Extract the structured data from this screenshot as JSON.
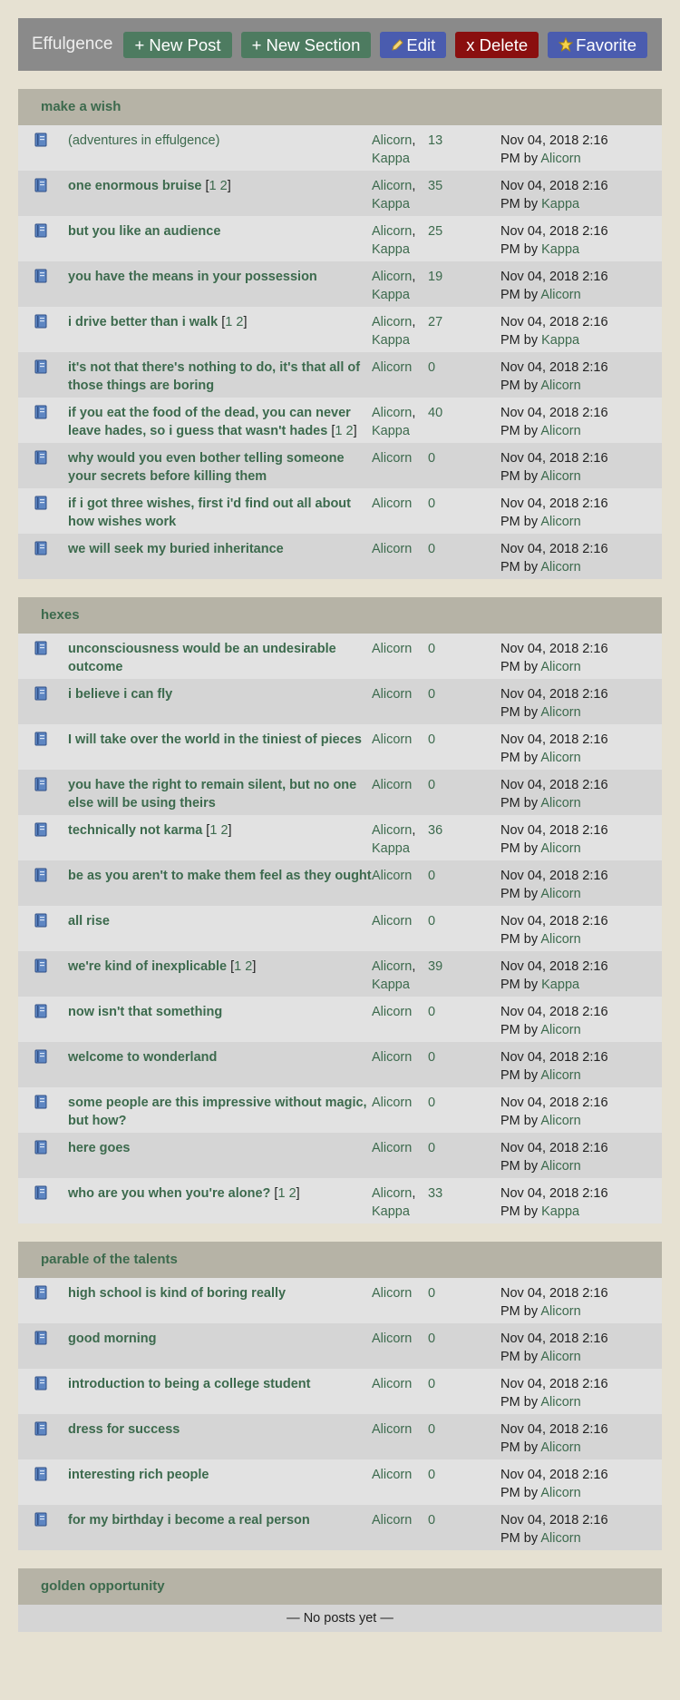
{
  "app": {
    "title": "Effulgence"
  },
  "toolbar": {
    "new_post": "+ New Post",
    "new_section": "+ New Section",
    "edit": "Edit",
    "delete": "x Delete",
    "favorite": "Favorite"
  },
  "colors": {
    "link": "#3c6a4d",
    "background": "#e6e1d2",
    "header": "#b6b3a6",
    "toolbar": "#8a8a8a"
  },
  "sections": [
    {
      "title": "make a wish",
      "posts": [
        {
          "title": "(adventures in effulgence)",
          "plain": true,
          "pages": [],
          "authors": [
            "Alicorn",
            "Kappa"
          ],
          "replies": "13",
          "date": "Nov 04, 2018 2:16 PM",
          "by": "by",
          "last_author": "Alicorn"
        },
        {
          "title": "one enormous bruise",
          "pages": [
            "1",
            "2"
          ],
          "authors": [
            "Alicorn",
            "Kappa"
          ],
          "replies": "35",
          "date": "Nov 04, 2018 2:16 PM",
          "by": "by",
          "last_author": "Kappa"
        },
        {
          "title": "but you like an audience",
          "pages": [],
          "authors": [
            "Alicorn",
            "Kappa"
          ],
          "replies": "25",
          "date": "Nov 04, 2018 2:16 PM",
          "by": "by",
          "last_author": "Kappa"
        },
        {
          "title": "you have the means in your possession",
          "pages": [],
          "authors": [
            "Alicorn",
            "Kappa"
          ],
          "replies": "19",
          "date": "Nov 04, 2018 2:16 PM",
          "by": "by",
          "last_author": "Alicorn"
        },
        {
          "title": "i drive better than i walk",
          "pages": [
            "1",
            "2"
          ],
          "authors": [
            "Alicorn",
            "Kappa"
          ],
          "replies": "27",
          "date": "Nov 04, 2018 2:16 PM",
          "by": "by",
          "last_author": "Kappa"
        },
        {
          "title": "it's not that there's nothing to do, it's that all of those things are boring",
          "pages": [],
          "authors": [
            "Alicorn"
          ],
          "replies": "0",
          "date": "Nov 04, 2018 2:16 PM",
          "by": "by",
          "last_author": "Alicorn"
        },
        {
          "title": "if you eat the food of the dead, you can never leave hades, so i guess that wasn't hades",
          "pages": [
            "1",
            "2"
          ],
          "authors": [
            "Alicorn",
            "Kappa"
          ],
          "replies": "40",
          "date": "Nov 04, 2018 2:16 PM",
          "by": "by",
          "last_author": "Alicorn"
        },
        {
          "title": "why would you even bother telling someone your secrets before killing them",
          "pages": [],
          "authors": [
            "Alicorn"
          ],
          "replies": "0",
          "date": "Nov 04, 2018 2:16 PM",
          "by": "by",
          "last_author": "Alicorn"
        },
        {
          "title": "if i got three wishes, first i'd find out all about how wishes work",
          "pages": [],
          "authors": [
            "Alicorn"
          ],
          "replies": "0",
          "date": "Nov 04, 2018 2:16 PM",
          "by": "by",
          "last_author": "Alicorn"
        },
        {
          "title": "we will seek my buried inheritance",
          "pages": [],
          "authors": [
            "Alicorn"
          ],
          "replies": "0",
          "date": "Nov 04, 2018 2:16 PM",
          "by": "by",
          "last_author": "Alicorn"
        }
      ]
    },
    {
      "title": "hexes",
      "posts": [
        {
          "title": "unconsciousness would be an undesirable outcome",
          "pages": [],
          "authors": [
            "Alicorn"
          ],
          "replies": "0",
          "date": "Nov 04, 2018 2:16 PM",
          "by": "by",
          "last_author": "Alicorn"
        },
        {
          "title": "i believe i can fly",
          "pages": [],
          "authors": [
            "Alicorn"
          ],
          "replies": "0",
          "date": "Nov 04, 2018 2:16 PM",
          "by": "by",
          "last_author": "Alicorn"
        },
        {
          "title": "I will take over the world in the tiniest of pieces",
          "pages": [],
          "authors": [
            "Alicorn"
          ],
          "replies": "0",
          "date": "Nov 04, 2018 2:16 PM",
          "by": "by",
          "last_author": "Alicorn"
        },
        {
          "title": "you have the right to remain silent, but no one else will be using theirs",
          "pages": [],
          "authors": [
            "Alicorn"
          ],
          "replies": "0",
          "date": "Nov 04, 2018 2:16 PM",
          "by": "by",
          "last_author": "Alicorn"
        },
        {
          "title": "technically not karma",
          "pages": [
            "1",
            "2"
          ],
          "authors": [
            "Alicorn",
            "Kappa"
          ],
          "replies": "36",
          "date": "Nov 04, 2018 2:16 PM",
          "by": "by",
          "last_author": "Alicorn"
        },
        {
          "title": "be as you aren't to make them feel as they ought",
          "pages": [],
          "authors": [
            "Alicorn"
          ],
          "replies": "0",
          "date": "Nov 04, 2018 2:16 PM",
          "by": "by",
          "last_author": "Alicorn"
        },
        {
          "title": "all rise",
          "pages": [],
          "authors": [
            "Alicorn"
          ],
          "replies": "0",
          "date": "Nov 04, 2018 2:16 PM",
          "by": "by",
          "last_author": "Alicorn"
        },
        {
          "title": "we're kind of inexplicable",
          "pages": [
            "1",
            "2"
          ],
          "authors": [
            "Alicorn",
            "Kappa"
          ],
          "replies": "39",
          "date": "Nov 04, 2018 2:16 PM",
          "by": "by",
          "last_author": "Kappa"
        },
        {
          "title": "now isn't that something",
          "pages": [],
          "authors": [
            "Alicorn"
          ],
          "replies": "0",
          "date": "Nov 04, 2018 2:16 PM",
          "by": "by",
          "last_author": "Alicorn"
        },
        {
          "title": "welcome to wonderland",
          "pages": [],
          "authors": [
            "Alicorn"
          ],
          "replies": "0",
          "date": "Nov 04, 2018 2:16 PM",
          "by": "by",
          "last_author": "Alicorn"
        },
        {
          "title": "some people are this impressive without magic, but how?",
          "pages": [],
          "authors": [
            "Alicorn"
          ],
          "replies": "0",
          "date": "Nov 04, 2018 2:16 PM",
          "by": "by",
          "last_author": "Alicorn"
        },
        {
          "title": "here goes",
          "pages": [],
          "authors": [
            "Alicorn"
          ],
          "replies": "0",
          "date": "Nov 04, 2018 2:16 PM",
          "by": "by",
          "last_author": "Alicorn"
        },
        {
          "title": "who are you when you're alone?",
          "pages": [
            "1",
            "2"
          ],
          "authors": [
            "Alicorn",
            "Kappa"
          ],
          "replies": "33",
          "date": "Nov 04, 2018 2:16 PM",
          "by": "by",
          "last_author": "Kappa"
        }
      ]
    },
    {
      "title": "parable of the talents",
      "posts": [
        {
          "title": "high school is kind of boring really",
          "pages": [],
          "authors": [
            "Alicorn"
          ],
          "replies": "0",
          "date": "Nov 04, 2018 2:16 PM",
          "by": "by",
          "last_author": "Alicorn"
        },
        {
          "title": "good morning",
          "pages": [],
          "authors": [
            "Alicorn"
          ],
          "replies": "0",
          "date": "Nov 04, 2018 2:16 PM",
          "by": "by",
          "last_author": "Alicorn"
        },
        {
          "title": "introduction to being a college student",
          "pages": [],
          "authors": [
            "Alicorn"
          ],
          "replies": "0",
          "date": "Nov 04, 2018 2:16 PM",
          "by": "by",
          "last_author": "Alicorn"
        },
        {
          "title": "dress for success",
          "pages": [],
          "authors": [
            "Alicorn"
          ],
          "replies": "0",
          "date": "Nov 04, 2018 2:16 PM",
          "by": "by",
          "last_author": "Alicorn"
        },
        {
          "title": "interesting rich people",
          "pages": [],
          "authors": [
            "Alicorn"
          ],
          "replies": "0",
          "date": "Nov 04, 2018 2:16 PM",
          "by": "by",
          "last_author": "Alicorn"
        },
        {
          "title": "for my birthday i become a real person",
          "pages": [],
          "authors": [
            "Alicorn"
          ],
          "replies": "0",
          "date": "Nov 04, 2018 2:16 PM",
          "by": "by",
          "last_author": "Alicorn"
        }
      ]
    },
    {
      "title": "golden opportunity",
      "posts": [],
      "empty_text": "— No posts yet —"
    }
  ]
}
